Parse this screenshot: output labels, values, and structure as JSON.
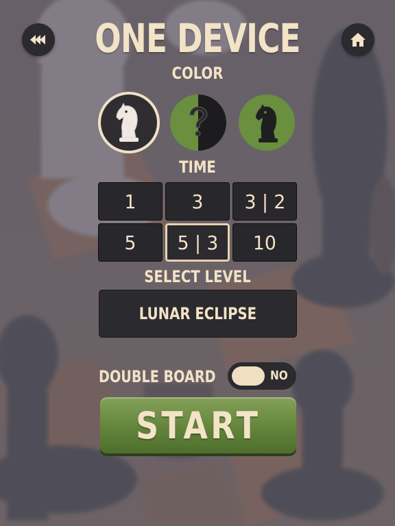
{
  "screen": {
    "title": "ONE DEVICE"
  },
  "color_section": {
    "label": "COLOR",
    "options": [
      {
        "id": "white",
        "icon": "white-knight-icon",
        "selected": true
      },
      {
        "id": "random",
        "icon": "question-mark-icon",
        "glyph": "?",
        "selected": false
      },
      {
        "id": "black",
        "icon": "black-knight-icon",
        "selected": false
      }
    ]
  },
  "time_section": {
    "label": "TIME",
    "options": [
      "1",
      "3",
      "3 | 2",
      "5",
      "5 | 3",
      "10"
    ],
    "selected": "5 | 3"
  },
  "level_section": {
    "label": "SELECT LEVEL",
    "value": "LUNAR ECLIPSE"
  },
  "double_board": {
    "label": "DOUBLE BOARD",
    "state": "NO"
  },
  "start_label": "START",
  "colors": {
    "text_cream": "#f3e3c7",
    "dark_panel": "#2b2a2e",
    "green": "#6a8f3f"
  },
  "icons": {
    "back": "rewind-icon",
    "home": "home-icon"
  }
}
